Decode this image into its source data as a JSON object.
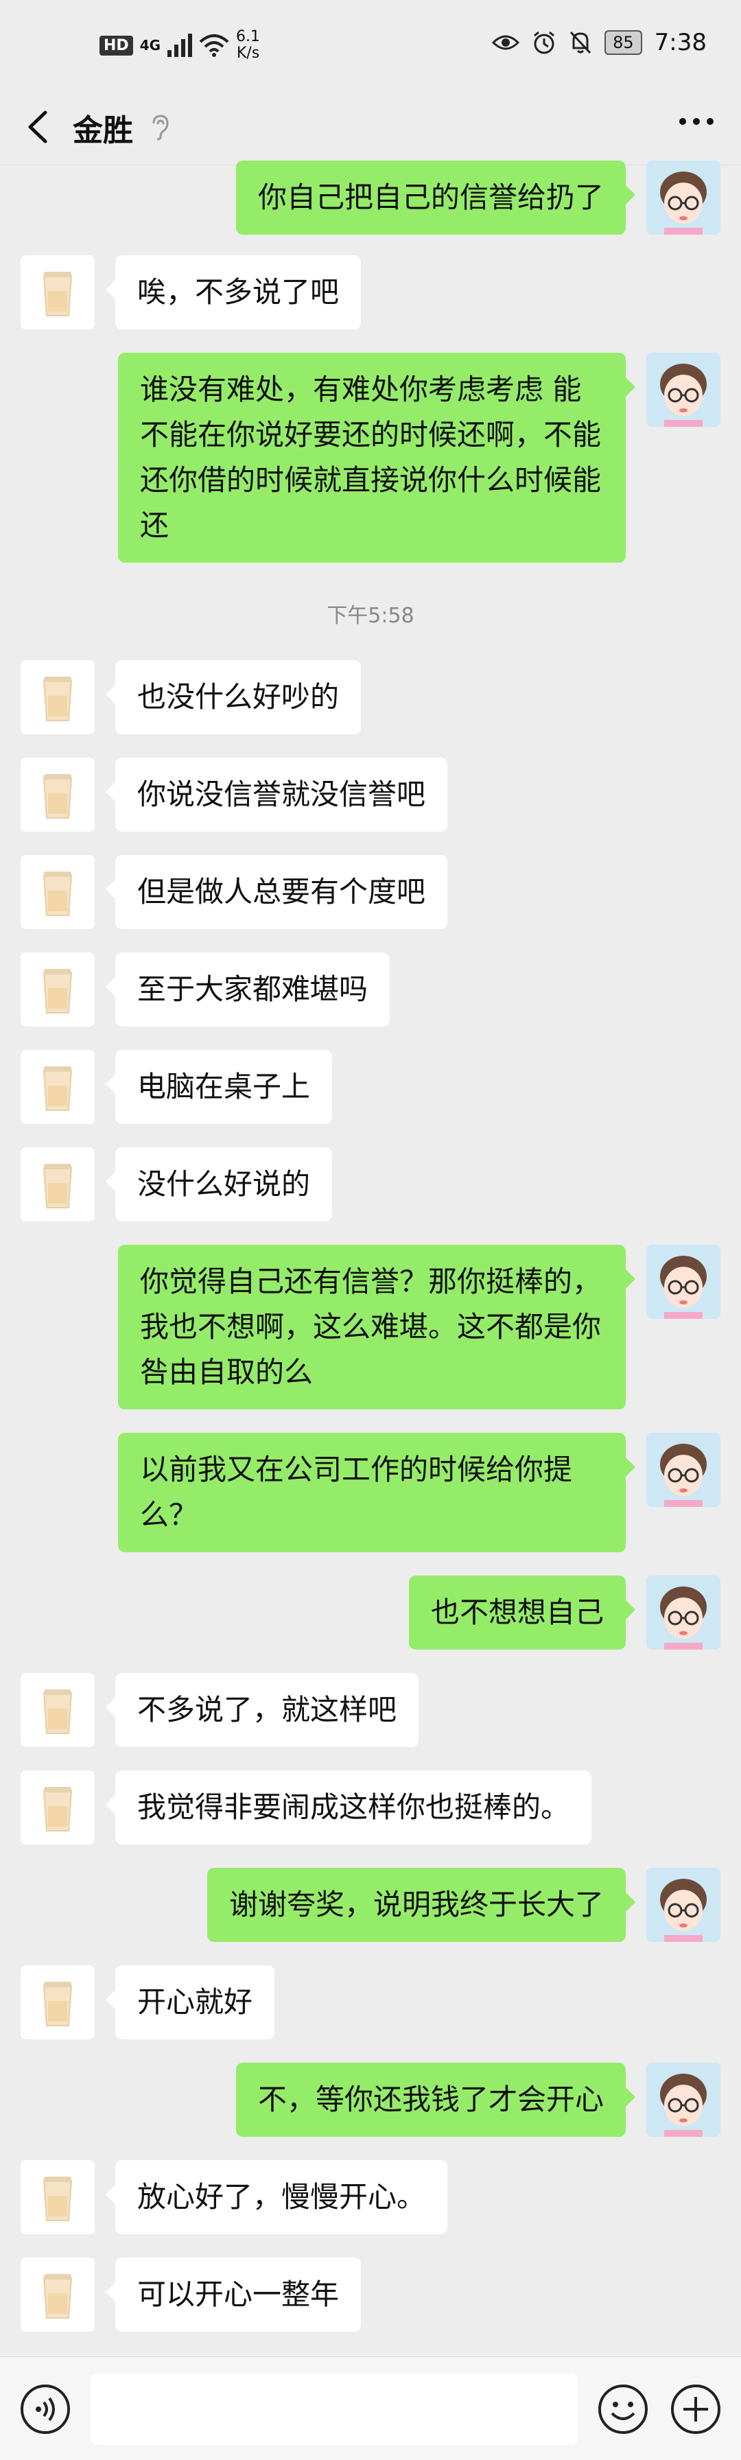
{
  "status_bar": {
    "hd": "HD",
    "network": "4G",
    "speed_value": "6.1",
    "speed_unit": "K/s",
    "battery": "85",
    "time": "7:38"
  },
  "header": {
    "title": "金胜"
  },
  "messages": [
    {
      "side": "right",
      "text": "你自己把自己的信誉给扔了"
    },
    {
      "side": "left",
      "text": "唉，不多说了吧"
    },
    {
      "side": "right",
      "text": "谁没有难处，有难处你考虑考虑 能不能在你说好要还的时候还啊，不能还你借的时候就直接说你什么时候能还"
    },
    {
      "side": "time",
      "text": "下午5:58"
    },
    {
      "side": "left",
      "text": "也没什么好吵的"
    },
    {
      "side": "left",
      "text": "你说没信誉就没信誉吧"
    },
    {
      "side": "left",
      "text": "但是做人总要有个度吧"
    },
    {
      "side": "left",
      "text": "至于大家都难堪吗"
    },
    {
      "side": "left",
      "text": "电脑在桌子上"
    },
    {
      "side": "left",
      "text": "没什么好说的"
    },
    {
      "side": "right",
      "text": "你觉得自己还有信誉？那你挺棒的，我也不想啊，这么难堪。这不都是你咎由自取的么"
    },
    {
      "side": "right",
      "text": "以前我又在公司工作的时候给你提么？"
    },
    {
      "side": "right",
      "text": "也不想想自己"
    },
    {
      "side": "left",
      "text": "不多说了，就这样吧"
    },
    {
      "side": "left",
      "text": "我觉得非要闹成这样你也挺棒的。"
    },
    {
      "side": "right",
      "text": "谢谢夸奖，说明我终于长大了"
    },
    {
      "side": "left",
      "text": "开心就好"
    },
    {
      "side": "right",
      "text": "不，等你还我钱了才会开心"
    },
    {
      "side": "left",
      "text": "放心好了，慢慢开心。"
    },
    {
      "side": "left",
      "text": "可以开心一整年"
    }
  ],
  "input_bar": {
    "placeholder": ""
  },
  "colors": {
    "background": "#ededed",
    "bubble_self": "#95ec69",
    "bubble_other": "#ffffff"
  }
}
